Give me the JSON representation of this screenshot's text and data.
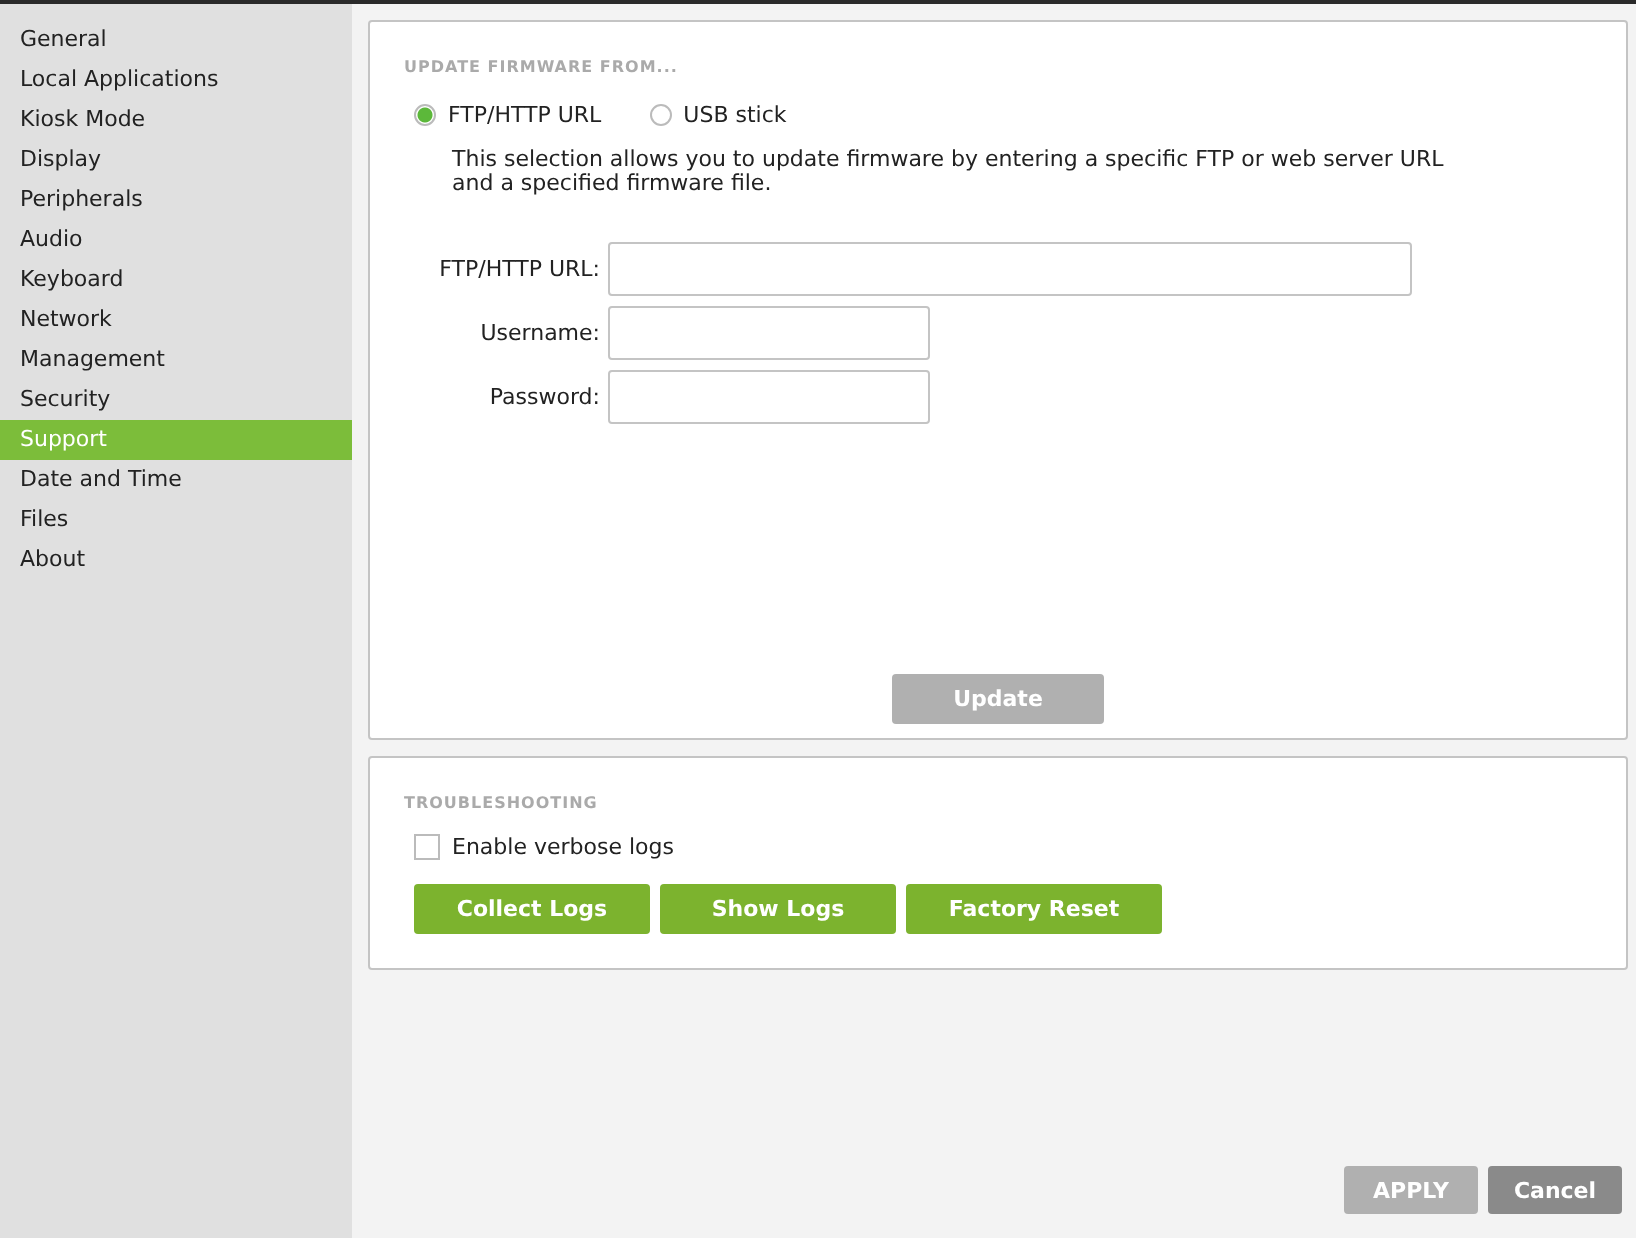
{
  "sidebar": {
    "items": [
      {
        "label": "General",
        "selected": false
      },
      {
        "label": "Local Applications",
        "selected": false
      },
      {
        "label": "Kiosk Mode",
        "selected": false
      },
      {
        "label": "Display",
        "selected": false
      },
      {
        "label": "Peripherals",
        "selected": false
      },
      {
        "label": "Audio",
        "selected": false
      },
      {
        "label": "Keyboard",
        "selected": false
      },
      {
        "label": "Network",
        "selected": false
      },
      {
        "label": "Management",
        "selected": false
      },
      {
        "label": "Security",
        "selected": false
      },
      {
        "label": "Support",
        "selected": true
      },
      {
        "label": "Date and Time",
        "selected": false
      },
      {
        "label": "Files",
        "selected": false
      },
      {
        "label": "About",
        "selected": false
      }
    ]
  },
  "firmware": {
    "heading": "UPDATE FIRMWARE FROM...",
    "sources": [
      {
        "label": "FTP/HTTP URL",
        "selected": true
      },
      {
        "label": "USB stick",
        "selected": false
      }
    ],
    "description": "This selection allows you to update firmware by entering a specific FTP or web server URL\nand a specified firmware file.",
    "fields": [
      {
        "label": "FTP/HTTP URL:",
        "kind": "wide"
      },
      {
        "label": "Username:",
        "kind": "short"
      },
      {
        "label": "Password:",
        "kind": "short"
      }
    ],
    "update_button": {
      "label": "Update",
      "disabled": true
    }
  },
  "troubleshooting": {
    "heading": "TROUBLESHOOTING",
    "verbose_logs": {
      "label": "Enable verbose logs",
      "checked": false
    },
    "buttons": [
      "Collect Logs",
      "Show Logs",
      "Factory Reset"
    ]
  },
  "footer": {
    "apply": {
      "label": "APPLY",
      "disabled": true
    },
    "cancel": {
      "label": "Cancel",
      "disabled": false
    }
  }
}
